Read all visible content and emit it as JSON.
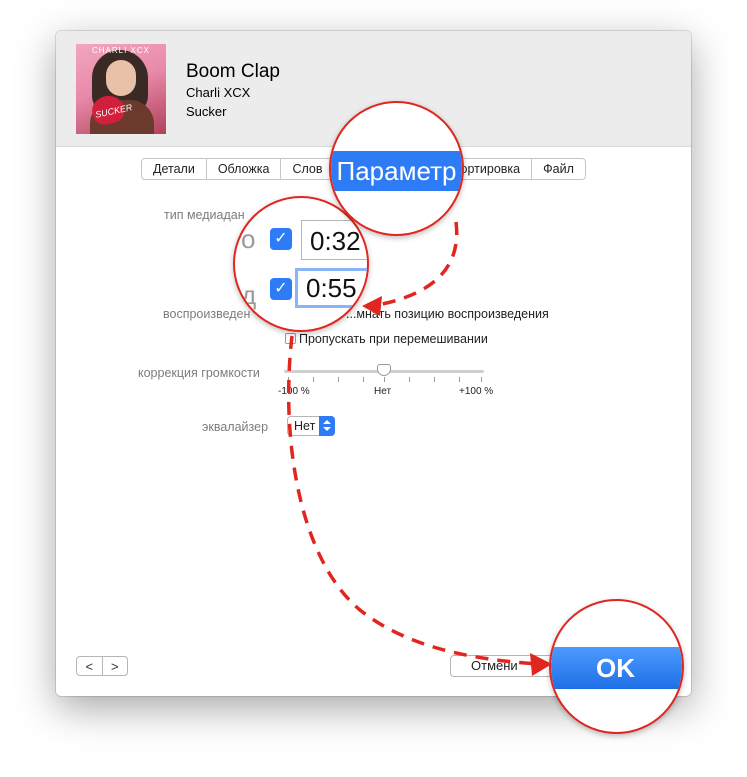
{
  "track": {
    "title": "Boom Clap",
    "artist": "Charli XCX",
    "album": "Sucker",
    "artwork": {
      "brand_text": "CHARLI XCX",
      "cover_text": "SUCKER"
    }
  },
  "tabs": [
    {
      "label": "Детали",
      "selected": false
    },
    {
      "label": "Обложка",
      "selected": false
    },
    {
      "label": "Слов",
      "selected": false
    },
    {
      "label": "Параметр",
      "selected": true
    },
    {
      "label": "Сортировка",
      "selected": false
    },
    {
      "label": "Файл",
      "selected": false
    }
  ],
  "options": {
    "media_type_label": "тип медиадан",
    "start_label_partial": "о",
    "stop_label_partial": "д",
    "start_time": "0:32",
    "stop_time": "0:55",
    "playback_label": "воспроизведен",
    "remember_position_label": "...мнать позицию воспроизведения",
    "skip_shuffle_label": "Пропускать при перемешивании",
    "skip_shuffle_checked": false,
    "volume_label": "коррекция громкости",
    "volume_min": "-100 %",
    "volume_mid": "Нет",
    "volume_max": "+100 %",
    "volume_value": 0,
    "equalizer_label": "эквалайзер",
    "equalizer_value": "Нет"
  },
  "footer": {
    "prev_label": "<",
    "next_label": ">",
    "cancel_label": "Отмени",
    "ok_label": "OK"
  },
  "colors": {
    "accent": "#2d7cf6",
    "annotation_red": "#e0261e"
  }
}
